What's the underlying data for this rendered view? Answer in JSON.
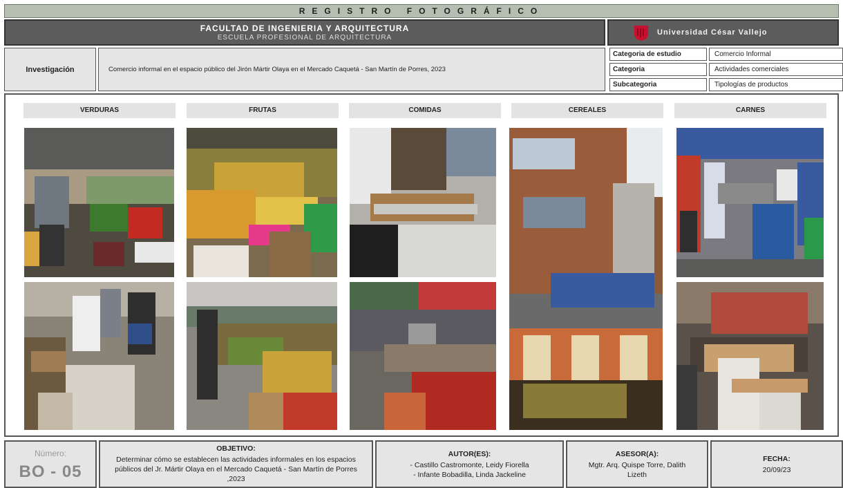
{
  "header": {
    "title": "REGISTRO FOTOGRÁFICO",
    "faculty": "FACULTAD DE INGENIERIA Y ARQUITECTURA",
    "school": "ESCUELA PROFESIONAL DE ARQUITECTURA",
    "university": "Universidad César Vallejo"
  },
  "research": {
    "label": "Investigación",
    "title": "Comercio informal en el espacio público del Jirón Mártir Olaya en el Mercado Caquetá - San Martín de Porres, 2023"
  },
  "classification": [
    {
      "key": "Categoria de estudio",
      "value": "Comercio Informal"
    },
    {
      "key": "Categoria",
      "value": "Actividades comerciales"
    },
    {
      "key": "Subcategoria",
      "value": "Tipologías de productos"
    }
  ],
  "columns": [
    "VERDURAS",
    "FRUTAS",
    "COMIDAS",
    "CEREALES",
    "CARNES"
  ],
  "footer": {
    "number_label": "Número:",
    "number_value": "BO - 05",
    "objective_title": "OBJETIVO:",
    "objective_text": "Determinar cómo se establecen las actividades informales en los espacios públicos del Jr. Mártir Olaya en el Mercado Caquetá - San Martín de Porres ,2023",
    "authors_title": "AUTOR(ES):",
    "author_1": "- Castillo Castromonte, Leidy Fiorella",
    "author_2": "- Infante Bobadilla, Linda Jackeline",
    "advisor_title": "ASESOR(A):",
    "advisor_name": "Mgtr. Arq. Quispe Torre, Dalith Lizeth",
    "date_title": "FECHA:",
    "date_value": "20/09/23"
  },
  "colors": {
    "brand_red": "#c8102e",
    "header_gray": "#5c5c5c",
    "title_green": "#b4bfb1"
  }
}
